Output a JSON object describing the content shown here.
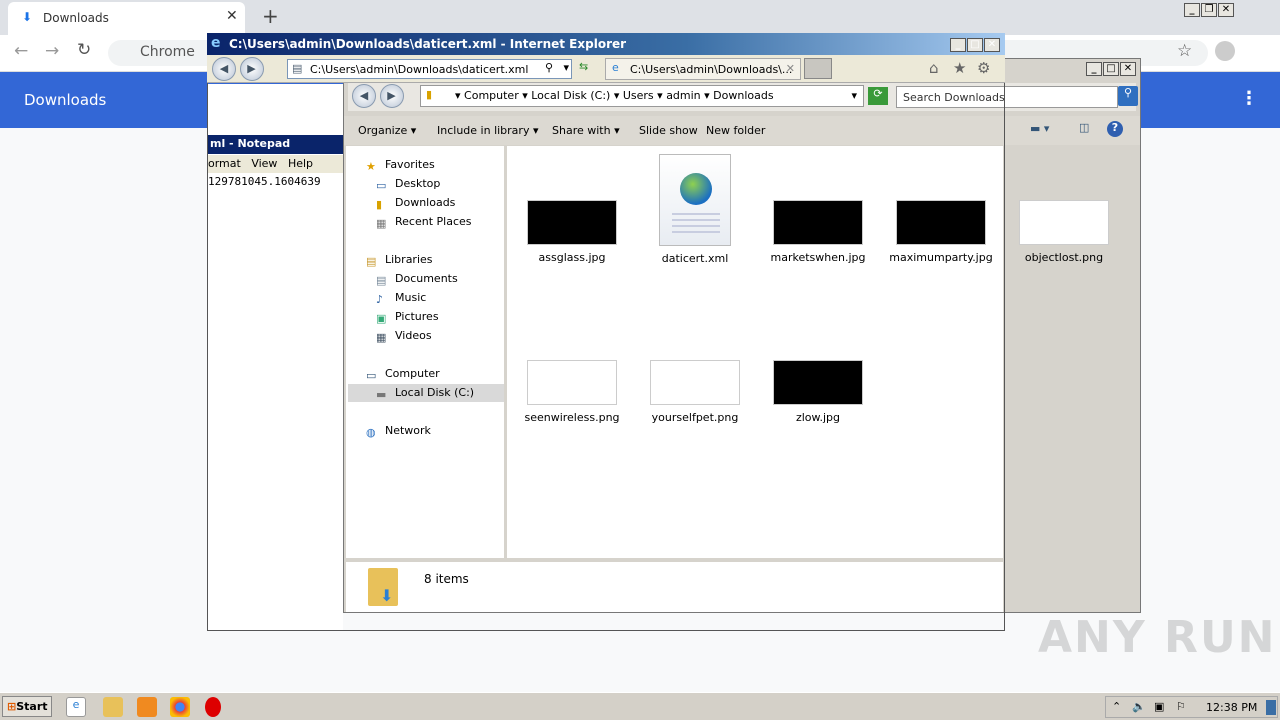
{
  "chrome": {
    "tab_title": "Downloads",
    "omnibox_text": "Chrome",
    "page_title": "Downloads"
  },
  "notepad": {
    "title": "ml - Notepad",
    "menu": [
      "ormat",
      "View",
      "Help"
    ],
    "content": "129781045.1604639"
  },
  "ie": {
    "title": "C:\\Users\\admin\\Downloads\\daticert.xml - Internet Explorer",
    "address": "C:\\Users\\admin\\Downloads\\daticert.xml",
    "tab_title": "C:\\Users\\admin\\Downloads\\..."
  },
  "explorer": {
    "breadcrumb": [
      "Computer",
      "Local Disk (C:)",
      "Users",
      "admin",
      "Downloads"
    ],
    "search_placeholder": "Search Downloads",
    "toolbar": [
      "Organize",
      "Include in library",
      "Share with",
      "Slide show",
      "New folder"
    ],
    "nav": [
      {
        "label": "Favorites",
        "icon": "star-icon"
      },
      {
        "label": "Desktop",
        "icon": "desktop-icon"
      },
      {
        "label": "Downloads",
        "icon": "downloads-folder-icon"
      },
      {
        "label": "Recent Places",
        "icon": "recent-places-icon"
      },
      {
        "label": "Libraries",
        "icon": "libraries-icon"
      },
      {
        "label": "Documents",
        "icon": "documents-icon"
      },
      {
        "label": "Music",
        "icon": "music-icon"
      },
      {
        "label": "Pictures",
        "icon": "pictures-icon"
      },
      {
        "label": "Videos",
        "icon": "videos-icon"
      },
      {
        "label": "Computer",
        "icon": "computer-icon"
      },
      {
        "label": "Local Disk (C:)",
        "icon": "disk-icon"
      },
      {
        "label": "Network",
        "icon": "network-icon"
      }
    ],
    "selected_nav": "Local Disk (C:)",
    "files": [
      {
        "name": "assglass.jpg",
        "thumb": "#000000"
      },
      {
        "name": "daticert.xml",
        "thumb": "xml"
      },
      {
        "name": "marketswhen.jpg",
        "thumb": "#000000"
      },
      {
        "name": "maximumparty.jpg",
        "thumb": "#000000"
      },
      {
        "name": "objectlost.png",
        "thumb": "#ffffff"
      },
      {
        "name": "seenwireless.png",
        "thumb": "#ffffff"
      },
      {
        "name": "yourselfpet.png",
        "thumb": "#ffffff"
      },
      {
        "name": "zlow.jpg",
        "thumb": "#000000"
      }
    ],
    "status": "8 items"
  },
  "taskbar": {
    "start": "Start",
    "clock": "12:38 PM"
  },
  "watermark": "ANY RUN"
}
